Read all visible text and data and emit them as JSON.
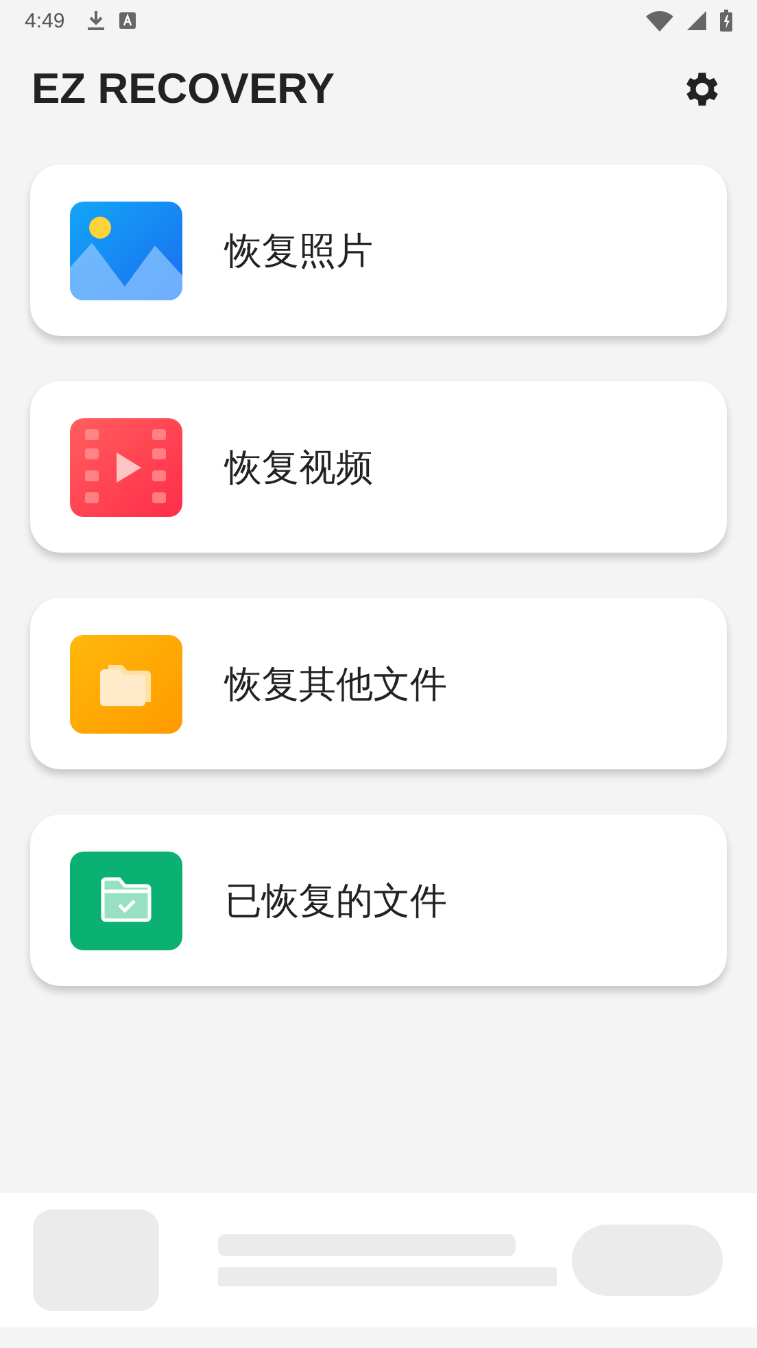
{
  "status_bar": {
    "time": "4:49"
  },
  "app_bar": {
    "title": "EZ RECOVERY"
  },
  "cards": [
    {
      "kind": "photo",
      "label": "恢复照片"
    },
    {
      "kind": "video",
      "label": "恢复视频"
    },
    {
      "kind": "files",
      "label": "恢复其他文件"
    },
    {
      "kind": "recovered",
      "label": "已恢复的文件"
    }
  ]
}
